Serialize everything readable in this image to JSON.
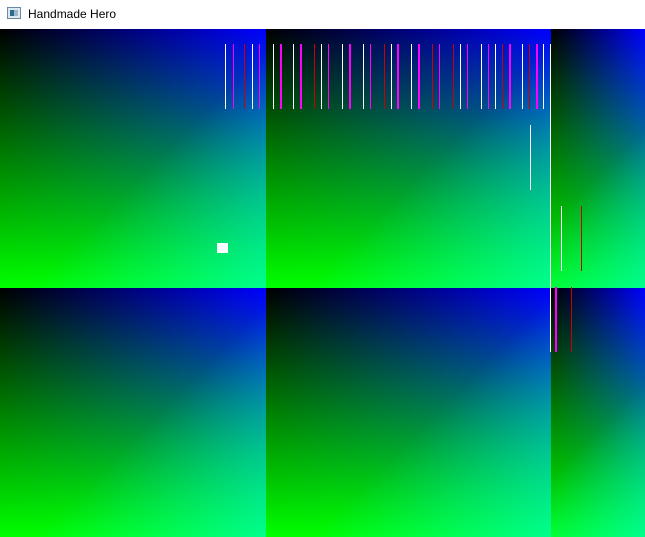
{
  "window": {
    "title": "Handmade Hero",
    "icon": "app-window-icon"
  },
  "colors": {
    "tile_top_left": "#000000",
    "tile_top_right": "#0000ff",
    "tile_bottom_left": "#00ff00",
    "tile_bottom_right": "#00ffff",
    "marker_white": "#ffffff",
    "marker_magenta": "#ff00ff",
    "marker_red": "#cc0000",
    "player": "#ffffff"
  }
}
